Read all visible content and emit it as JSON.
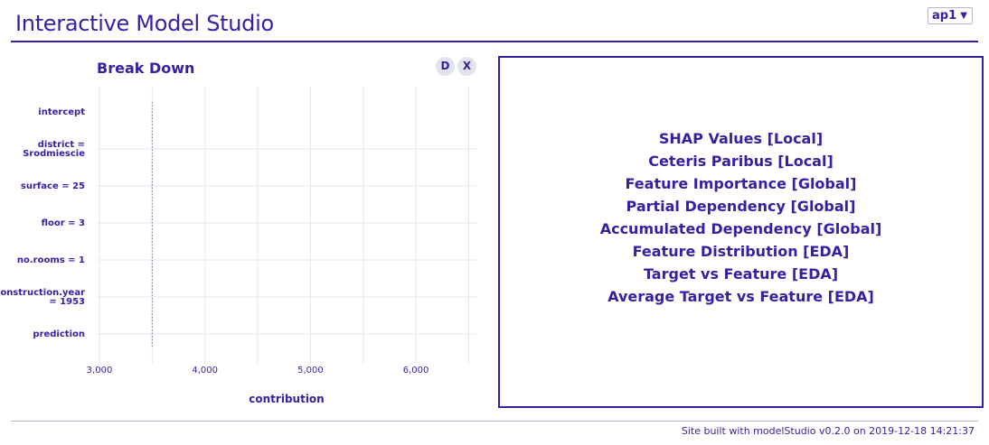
{
  "header": {
    "title": "Interactive Model Studio",
    "observation_select": {
      "value": "ap1",
      "caret": "▼"
    }
  },
  "left_panel": {
    "plot_title": "Break Down",
    "buttons": {
      "d_label": "D",
      "x_label": "X"
    }
  },
  "chart_data": {
    "type": "bar",
    "title": "Break Down",
    "xlabel": "contribution",
    "ylabel": "",
    "xlim": [
      3000,
      6500
    ],
    "x_ticks": [
      3000,
      4000,
      5000,
      6000
    ],
    "x_tick_labels": [
      "3,000",
      "4,000",
      "5,000",
      "6,000"
    ],
    "categories": [
      [
        "intercept"
      ],
      [
        "district =",
        "Srodmiescie"
      ],
      [
        "surface = 25"
      ],
      [
        "floor = 3"
      ],
      [
        "no.rooms = 1"
      ],
      [
        "construction.year",
        "= 1953"
      ],
      [
        "prediction"
      ]
    ],
    "reference_line": 3500,
    "grid": true,
    "colors": {
      "text": "#371ea3",
      "grid": "#e6e6ee",
      "reference_line": "#8a85a8"
    }
  },
  "right_panel": {
    "choices": [
      "SHAP Values [Local]",
      "Ceteris Paribus [Local]",
      "Feature Importance [Global]",
      "Partial Dependency [Global]",
      "Accumulated Dependency [Global]",
      "Feature Distribution [EDA]",
      "Target vs Feature [EDA]",
      "Average Target vs Feature [EDA]"
    ]
  },
  "footer": {
    "text": "Site built with modelStudio v0.2.0 on 2019-12-18 14:21:37"
  }
}
